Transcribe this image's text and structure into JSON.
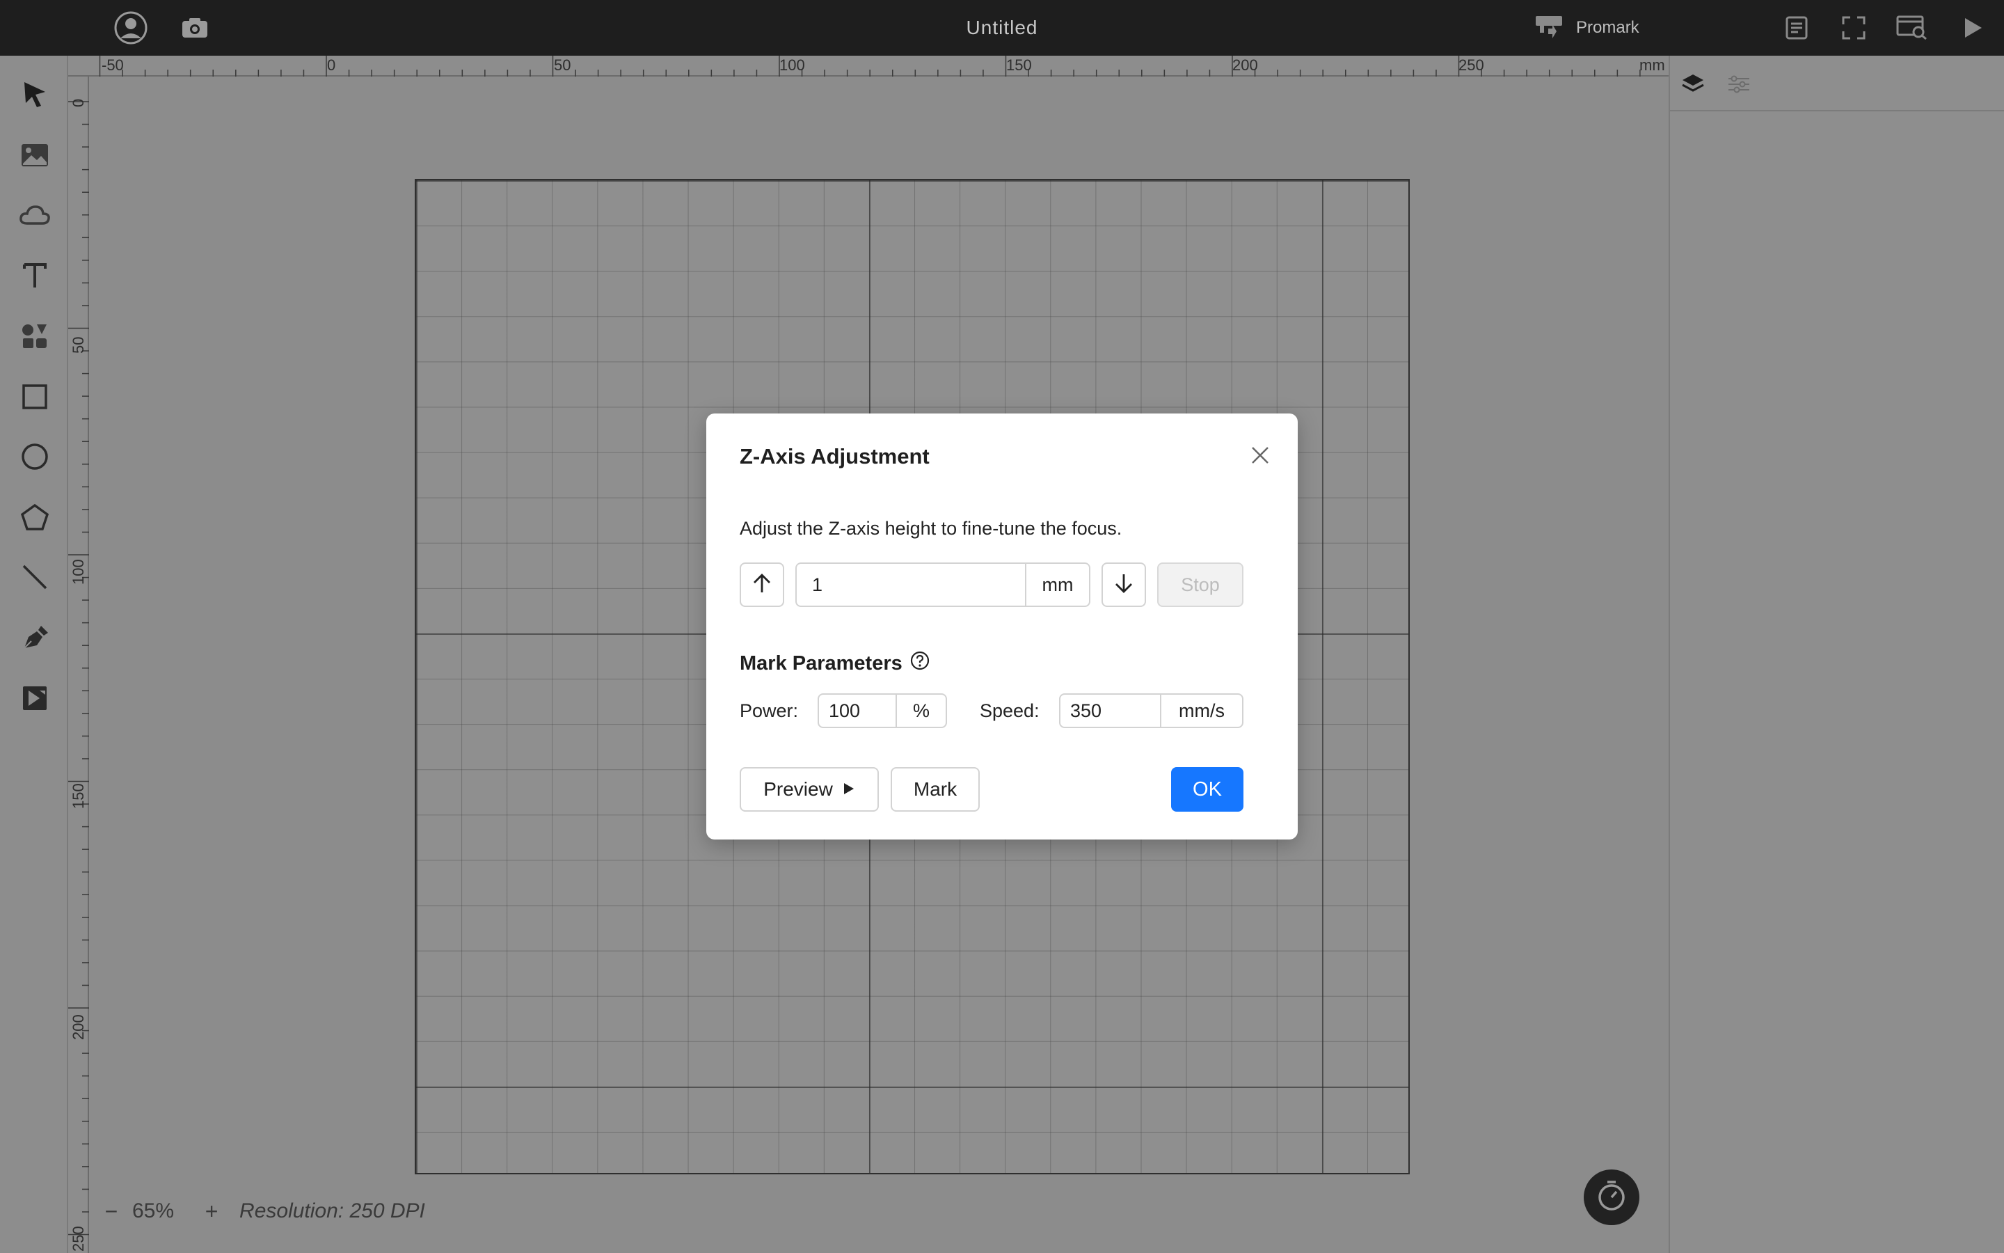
{
  "window": {
    "title": "Untitled"
  },
  "machine": {
    "name": "Promark"
  },
  "icons": {
    "top_left": [
      "user-account-icon",
      "camera-icon"
    ],
    "top_right": [
      "task-list-icon",
      "fullscreen-icon",
      "preview-window-icon",
      "run-icon"
    ],
    "toolbar": [
      "select-arrow-icon",
      "image-icon",
      "cloud-icon",
      "text-icon",
      "elements-icon",
      "rectangle-icon",
      "ellipse-icon",
      "polygon-icon",
      "line-icon",
      "pen-icon",
      "dmkt-icon"
    ],
    "right_panel": [
      "layers-icon",
      "object-settings-icon"
    ]
  },
  "ruler": {
    "unit": "mm",
    "top_labels": [
      "-50",
      "0",
      "50",
      "100",
      "150",
      "200",
      "250"
    ],
    "left_labels": [
      "0",
      "50",
      "100",
      "150",
      "200",
      "250"
    ]
  },
  "status": {
    "zoom_minus": "−",
    "zoom": "65%",
    "zoom_plus": "+",
    "resolution": "Resolution: 250 DPI"
  },
  "dialog": {
    "title": "Z-Axis Adjustment",
    "description": "Adjust the Z-axis height to fine-tune the focus.",
    "z_step": {
      "value": "1",
      "unit": "mm"
    },
    "stop_label": "Stop",
    "mark_parameters": {
      "title": "Mark Parameters",
      "power_label": "Power:",
      "power_value": "100",
      "power_unit": "%",
      "speed_label": "Speed:",
      "speed_value": "350",
      "speed_unit": "mm/s"
    },
    "preview_label": "Preview",
    "mark_label": "Mark",
    "ok_label": "OK"
  },
  "colors": {
    "accent": "#1677ff",
    "topbar": "#1e1e1e",
    "overlay_canvas": "#8c8c8c"
  }
}
